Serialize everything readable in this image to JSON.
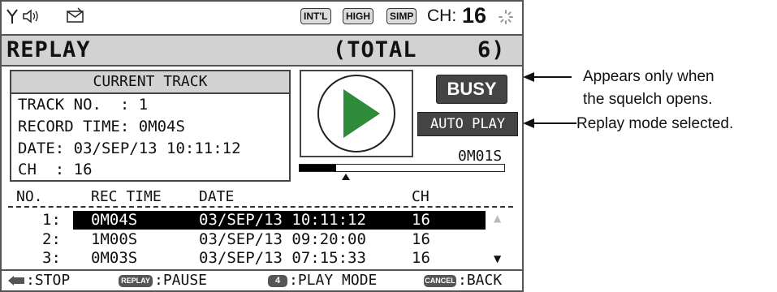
{
  "status_bar": {
    "badges": [
      "INT'L",
      "HIGH",
      "SIMP"
    ],
    "channel_label": "CH:",
    "channel_value": "16"
  },
  "title": {
    "label": "REPLAY",
    "total_label": "(TOTAL",
    "total_value": "6)"
  },
  "current_track": {
    "header": "CURRENT TRACK",
    "track_no": "TRACK NO.  : 1",
    "record_time": "RECORD TIME: 0M04S",
    "date": "DATE: 03/SEP/13 10:11:12",
    "ch": "CH  : 16"
  },
  "player": {
    "busy_label": "BUSY",
    "mode_label": "AUTO PLAY",
    "elapsed": "0M01S",
    "progress": 0.23
  },
  "list": {
    "headers": {
      "no": "NO.",
      "rec_time": "REC TIME",
      "date": "DATE",
      "ch": "CH"
    },
    "rows": [
      {
        "no": "1:",
        "rec_time": "0M04S",
        "date": "03/SEP/13 10:11:12",
        "ch": "16"
      },
      {
        "no": "2:",
        "rec_time": "1M00S",
        "date": "03/SEP/13 09:20:00",
        "ch": "16"
      },
      {
        "no": "3:",
        "rec_time": "0M03S",
        "date": "03/SEP/13 07:15:33",
        "ch": "16"
      }
    ],
    "scroll_up": "▲",
    "scroll_down": "▼"
  },
  "footer": {
    "stop": ":STOP",
    "replay_key": "REPLAY",
    "pause": ":PAUSE",
    "play_mode_key": "4",
    "play_mode": ":PLAY MODE",
    "cancel_key": "CANCEL",
    "back": ":BACK"
  },
  "callouts": {
    "busy_note_line1": "Appears only when",
    "busy_note_line2": "the squelch opens.",
    "mode_note": "Replay mode selected."
  },
  "colors": {
    "play_triangle": "#2e8b3a",
    "title_bar": "#d2d2d2",
    "badge": "#444444"
  }
}
